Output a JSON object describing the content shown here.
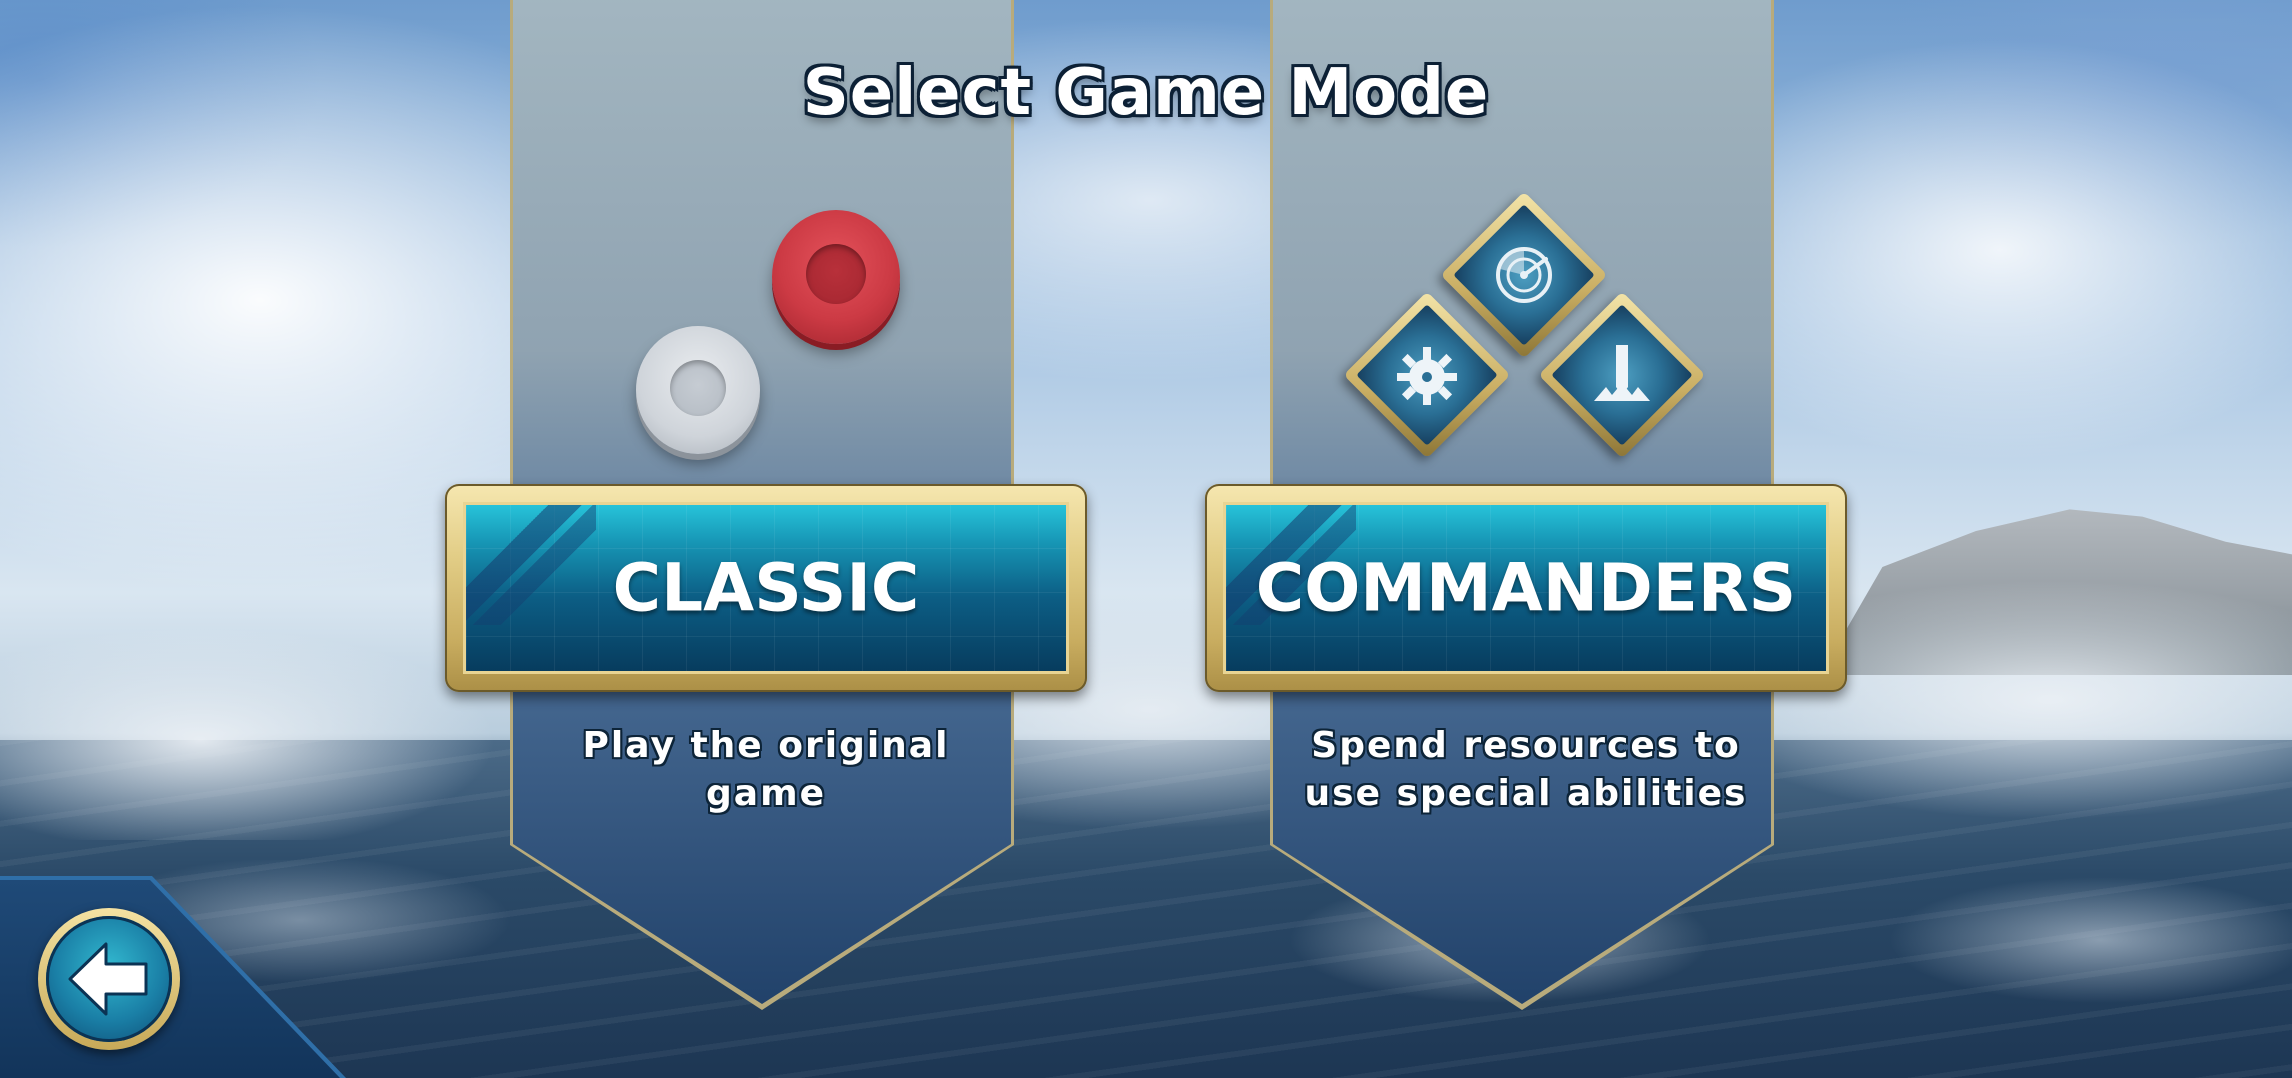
{
  "screen": {
    "title": "Select Game Mode"
  },
  "modes": [
    {
      "id": "classic",
      "label": "CLASSIC",
      "description_line1": "Play the original",
      "description_line2": "game",
      "icons": [
        "red-disc-icon",
        "white-disc-icon"
      ]
    },
    {
      "id": "commanders",
      "label": "COMMANDERS",
      "description_line1": "Spend resources to",
      "description_line2": "use special abilities",
      "icons": [
        "radar-ability-icon",
        "mine-ability-icon",
        "strike-ability-icon"
      ]
    }
  ],
  "navigation": {
    "back_icon": "back-arrow-icon"
  },
  "colors": {
    "button_gold": "#e2cd86",
    "button_cyan": "#27c3d9",
    "button_navy": "#073c5e",
    "disc_red": "#cc3a44",
    "disc_white": "#cfd4da",
    "title_outline": "#0c2035"
  }
}
